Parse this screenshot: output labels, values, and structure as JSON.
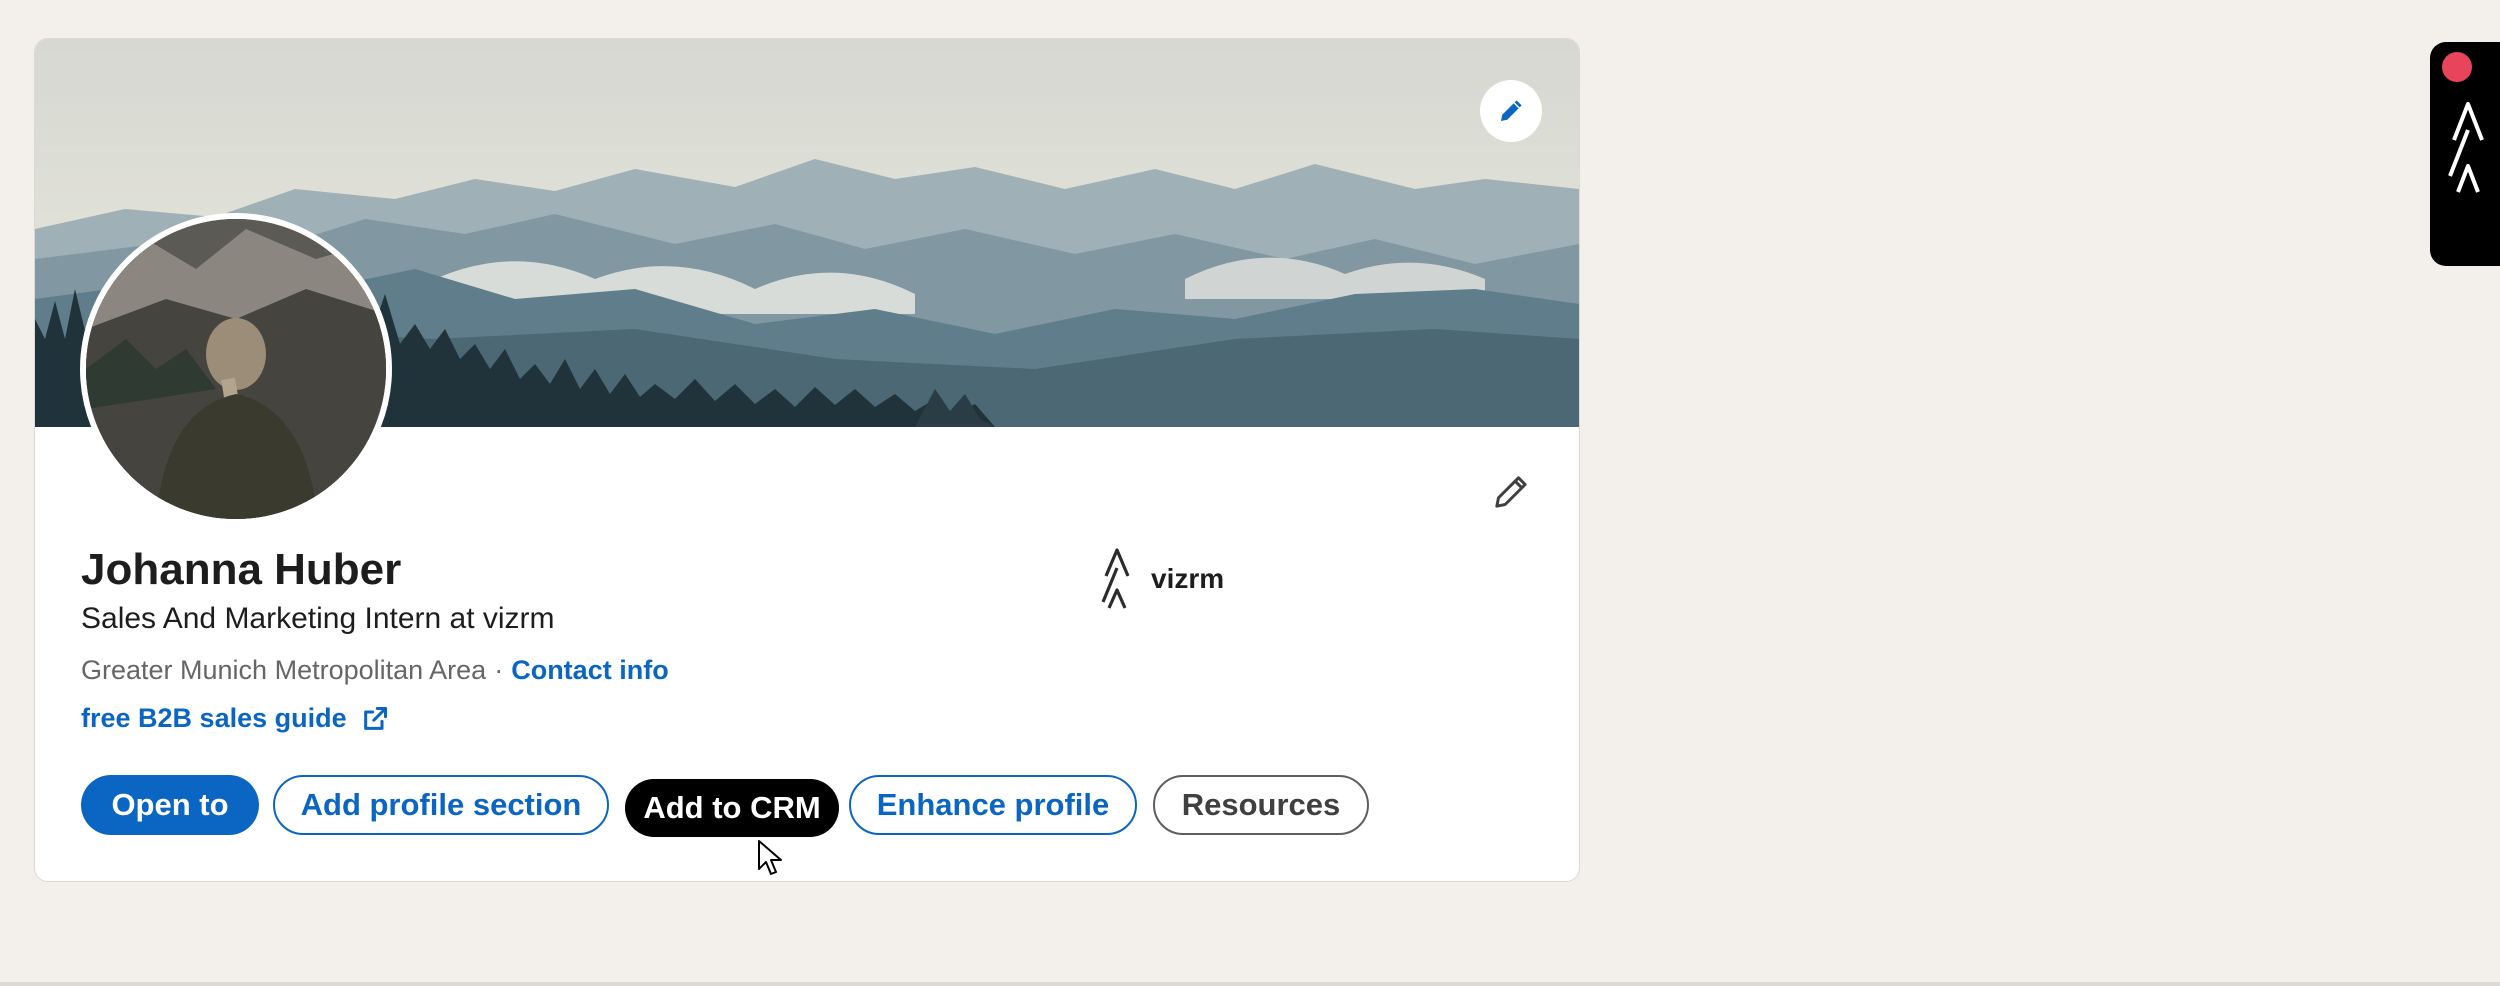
{
  "profile": {
    "name": "Johanna Huber",
    "headline": "Sales And Marketing Intern at vizrm",
    "location": "Greater Munich Metropolitan Area",
    "separator": "·",
    "contact_info": "Contact info",
    "website_label": "free B2B sales guide"
  },
  "company": {
    "name": "vizrm",
    "logo_icon": "vizrm-logo-icon"
  },
  "actions": {
    "open_to": "Open to",
    "add_profile_section": "Add profile section",
    "add_to_crm": "Add to CRM",
    "enhance_profile": "Enhance profile",
    "resources": "Resources"
  },
  "icons": {
    "banner_edit": "pencil-icon",
    "intro_edit": "pencil-icon",
    "website": "external-link-icon",
    "side_widget": "vizrm-logo-icon",
    "side_widget_badge": "notification-dot"
  },
  "colors": {
    "page_background": "#f3f0eb",
    "brand_blue": "#0a66c2",
    "crm_button": "#000000",
    "badge_red": "#e8455d"
  }
}
